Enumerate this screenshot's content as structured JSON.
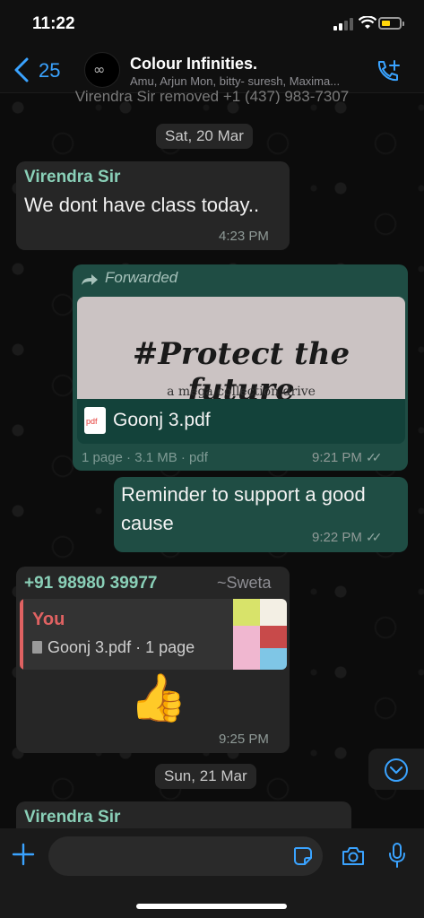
{
  "status_bar": {
    "time": "11:22"
  },
  "header": {
    "back_count": "25",
    "group_name": "Colour Infinities.",
    "members": "Amu, Arjun Mon, bitty- suresh, Maxima..."
  },
  "system_message": "Virendra Sir removed +1 (437) 983-7307",
  "dates": [
    "Sat, 20 Mar",
    "Sun, 21 Mar"
  ],
  "messages": [
    {
      "sender": "Virendra Sir",
      "text": "We dont have class today..",
      "time": "4:23 PM"
    },
    {
      "forwarded_label": "Forwarded",
      "preview_title": "#Protect the future",
      "preview_subtitle": "a mega collection drive",
      "file_name": "Goonj 3.pdf",
      "file_icon_label": "pdf",
      "file_meta": "1 page · 3.1 MB · pdf",
      "time": "9:21 PM"
    },
    {
      "text": "Reminder to support a good cause",
      "time": "9:22 PM"
    },
    {
      "sender": "+91 98980 39977",
      "sender_alias": "~Sweta",
      "quote_author": "You",
      "quote_file": "Goonj 3.pdf · 1 page",
      "emoji": "👍",
      "time": "9:25 PM"
    },
    {
      "sender": "Virendra Sir"
    }
  ],
  "composer": {
    "placeholder": ""
  },
  "colors": {
    "accent": "#3aa3ff",
    "outgoing": "#005c4b",
    "incoming": "#262626",
    "sender": "#8ad0b8",
    "quote": "#e06262"
  }
}
